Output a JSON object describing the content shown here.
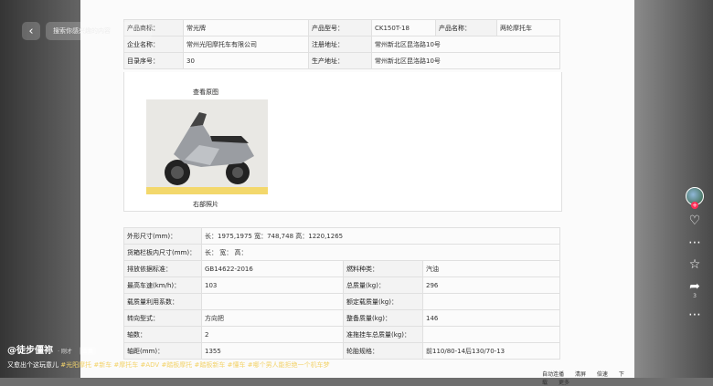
{
  "table1": [
    [
      {
        "l": "产品商标：",
        "v": "常光牌"
      },
      {
        "l": "产品型号：",
        "v": "CK150T-18"
      },
      {
        "l": "产品名称：",
        "v": "两轮摩托车"
      }
    ],
    [
      {
        "l": "企业名称：",
        "v": "常州光阳摩托车有限公司"
      },
      {
        "l": "注册地址：",
        "v": "常州新北区昆洛路10号"
      }
    ],
    [
      {
        "l": "目录序号：",
        "v": "30"
      },
      {
        "l": "生产地址：",
        "v": "常州新北区昆洛路10号"
      }
    ]
  ],
  "photo": {
    "title": "查看原图",
    "caption": "右部照片"
  },
  "table2_full": [
    {
      "l": "外形尺寸(mm)：",
      "v": "长：1975,1975 宽：748,748 高：1220,1265"
    },
    {
      "l": "货箱栏板内尺寸(mm)：",
      "v": "长： 宽： 高："
    }
  ],
  "table2_rows": [
    {
      "l1": "排放依据标准：",
      "v1": "GB14622-2016",
      "l2": "燃料种类：",
      "v2": "汽油"
    },
    {
      "l1": "最高车速(km/h)：",
      "v1": "103",
      "l2": "总质量(kg)：",
      "v2": "296"
    },
    {
      "l1": "载质量利用系数：",
      "v1": "",
      "l2": "额定载质量(kg)：",
      "v2": ""
    },
    {
      "l1": "转向型式：",
      "v1": "方向把",
      "l2": "整备质量(kg)：",
      "v2": "146"
    },
    {
      "l1": "轴数：",
      "v1": "2",
      "l2": "准拖挂车总质量(kg)：",
      "v2": ""
    },
    {
      "l1": "轴距(mm)：",
      "v1": "1355",
      "l2": "轮胎规格：",
      "v2": "前110/80-14后130/70-13"
    }
  ],
  "ui": {
    "back_icon": "‹",
    "search_text": "搜索你感兴趣的内容",
    "like_count": "",
    "comment_count": "",
    "star_count": "",
    "share_count": "3",
    "author": "@徒步僵祢",
    "time": "· 刚才",
    "tag": "合集",
    "desc": "又愈出个这玩意儿",
    "hashtags": "#光阳摩托 #新车 #摩托车 #ADV #踏板摩托 #踏板新车 #懂车 #哪个男人能拒绝一个机车梦",
    "controls": [
      "自动连播",
      "清屏",
      "倍速",
      "下载",
      "更多"
    ]
  },
  "colors": {
    "accent": "#fe2c55",
    "hashtag": "#f3d36b"
  }
}
